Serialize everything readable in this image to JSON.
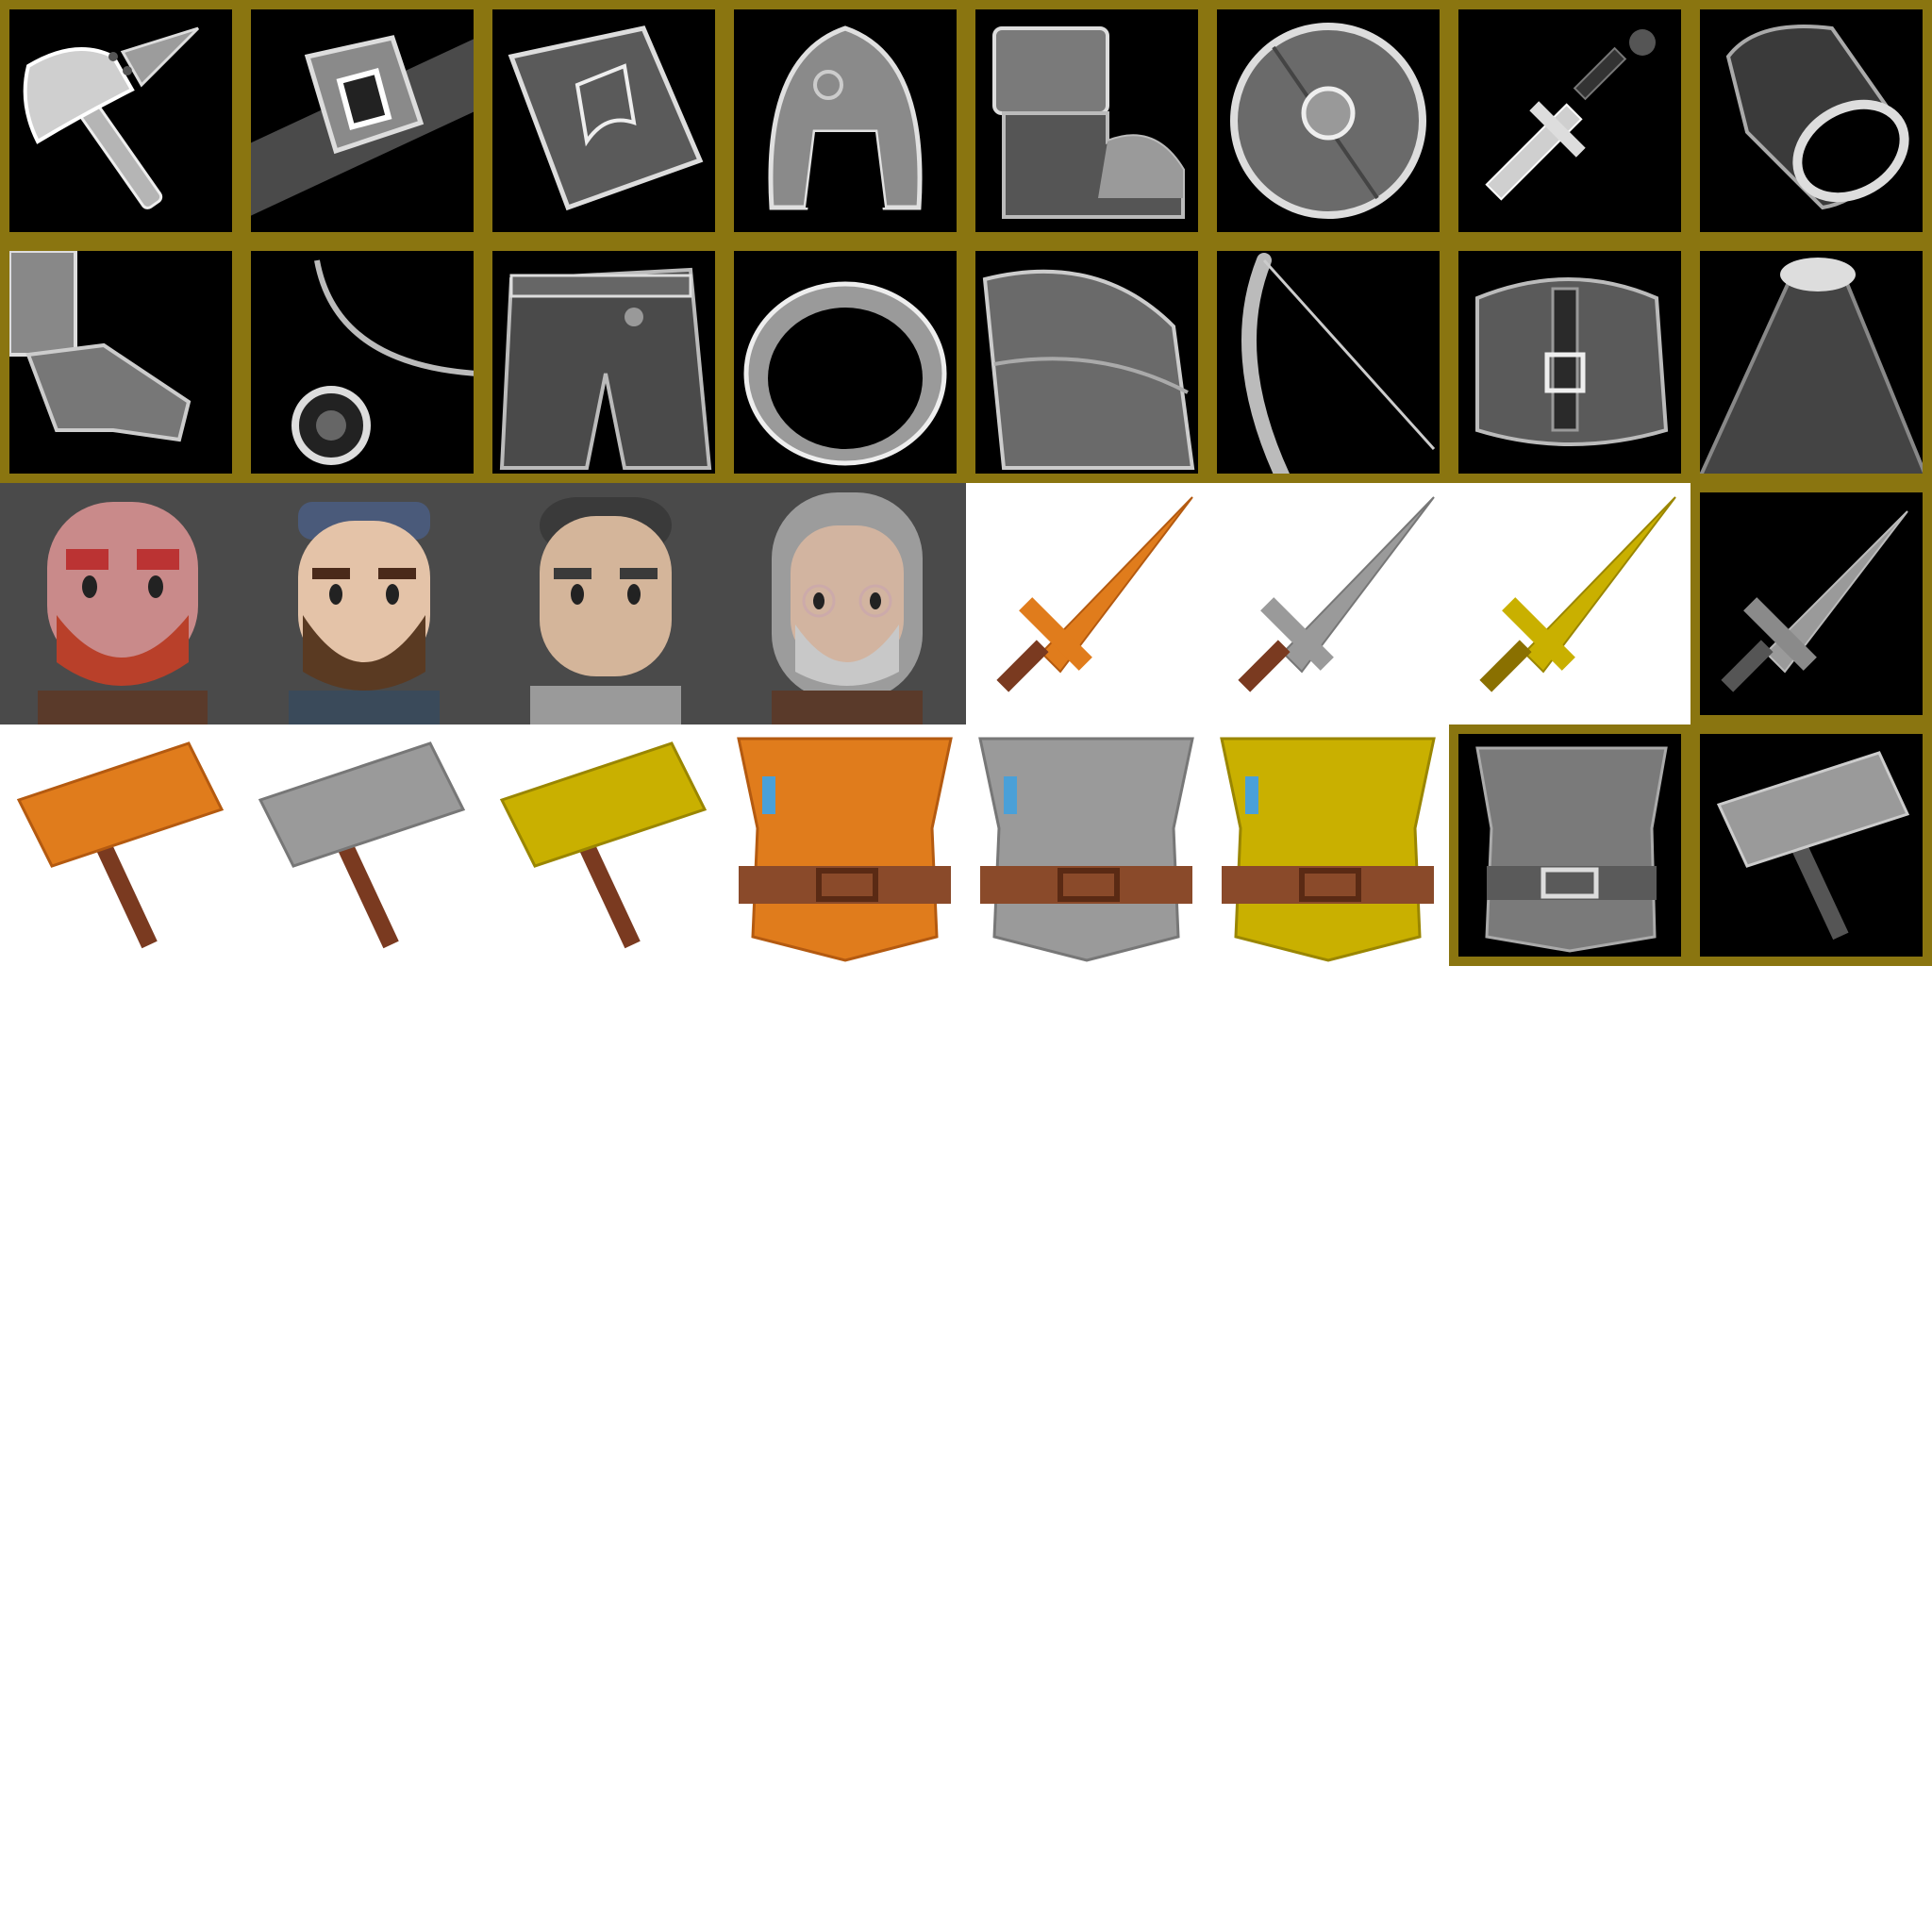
{
  "atlas": {
    "frame_color": "#8a7510",
    "tile_bg": "#000000",
    "portrait_bg": "#4a4a4a",
    "tints": {
      "bronze": "#e07c1c",
      "silver": "#9a9a9a",
      "gold": "#c9b000"
    }
  },
  "row1": [
    "axe-icon",
    "belt-icon",
    "spellbook-icon",
    "helmet-icon",
    "boot-icon",
    "shield-icon",
    "sword-icon",
    "bracer-icon"
  ],
  "row2": [
    "gauntlet-icon",
    "amulet-icon",
    "pants-icon",
    "ring-icon",
    "pauldron-icon",
    "bow-icon",
    "bag-icon",
    "cloak-icon"
  ],
  "portraits": [
    "red-bearded-warrior-portrait",
    "bearded-hat-man-portrait",
    "armored-knight-portrait",
    "old-man-glasses-portrait"
  ],
  "row3_items": [
    "bronze-sword-icon",
    "silver-sword-icon",
    "gold-sword-icon",
    "framed-sword-icon"
  ],
  "row4_items": [
    "bronze-hammer-icon",
    "silver-hammer-icon",
    "gold-hammer-icon",
    "bronze-chest-armor-icon",
    "silver-chest-armor-icon",
    "gold-chest-armor-icon",
    "framed-chest-armor-icon",
    "framed-hammer-icon"
  ]
}
